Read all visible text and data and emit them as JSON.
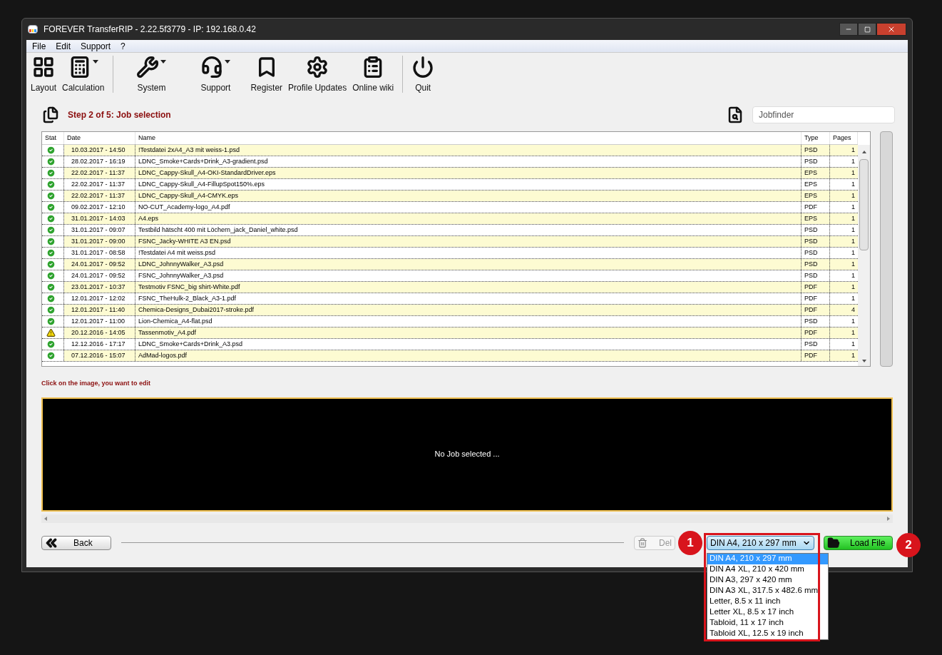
{
  "window": {
    "title": "FOREVER TransferRIP - 2.22.5f3779 - IP: 192.168.0.42"
  },
  "menu": [
    "File",
    "Edit",
    "Support",
    "?"
  ],
  "toolbar": [
    {
      "label": "Layout",
      "kind": "layout",
      "has_menu": false
    },
    {
      "label": "Calculation",
      "kind": "calculator",
      "has_menu": true
    },
    {
      "label": "System",
      "kind": "tools",
      "has_menu": true
    },
    {
      "label": "Support",
      "kind": "headset",
      "has_menu": true
    },
    {
      "label": "Register",
      "kind": "bookmark",
      "has_menu": false
    },
    {
      "label": "Profile Updates",
      "kind": "gears",
      "has_menu": false
    },
    {
      "label": "Online wiki",
      "kind": "clipboard",
      "has_menu": false
    },
    {
      "label": "Quit",
      "kind": "power",
      "has_menu": false
    }
  ],
  "step_title": "Step 2 of 5: Job selection",
  "jobfinder": {
    "placeholder": "Jobfinder"
  },
  "table": {
    "columns": [
      "Stat",
      "Date",
      "Name",
      "Type",
      "Pages"
    ],
    "rows": [
      {
        "kind": "ok",
        "date": "10.03.2017 - 14:50",
        "name": "!Testdatei 2xA4_A3 mit weiss-1.psd",
        "type": "PSD",
        "pages": "1"
      },
      {
        "kind": "ok",
        "date": "28.02.2017 - 16:19",
        "name": "LDNC_Smoke+Cards+Drink_A3-gradient.psd",
        "type": "PSD",
        "pages": "1"
      },
      {
        "kind": "ok",
        "date": "22.02.2017 - 11:37",
        "name": "LDNC_Cappy-Skull_A4-OKI-StandardDriver.eps",
        "type": "EPS",
        "pages": "1"
      },
      {
        "kind": "ok",
        "date": "22.02.2017 - 11:37",
        "name": "LDNC_Cappy-Skull_A4-FillupSpot150%.eps",
        "type": "EPS",
        "pages": "1"
      },
      {
        "kind": "ok",
        "date": "22.02.2017 - 11:37",
        "name": "LDNC_Cappy-Skull_A4-CMYK.eps",
        "type": "EPS",
        "pages": "1"
      },
      {
        "kind": "ok",
        "date": "09.02.2017 - 12:10",
        "name": "NO-CUT_Academy-logo_A4.pdf",
        "type": "PDF",
        "pages": "1"
      },
      {
        "kind": "ok",
        "date": "31.01.2017 - 14:03",
        "name": "A4.eps",
        "type": "EPS",
        "pages": "1"
      },
      {
        "kind": "ok",
        "date": "31.01.2017 - 09:07",
        "name": "Testbild hätscht 400 mit Löchern_jack_Daniel_white.psd",
        "type": "PSD",
        "pages": "1"
      },
      {
        "kind": "ok",
        "date": "31.01.2017 - 09:00",
        "name": "FSNC_Jacky-WHITE A3 EN.psd",
        "type": "PSD",
        "pages": "1"
      },
      {
        "kind": "ok",
        "date": "31.01.2017 - 08:58",
        "name": "!Testdatei A4 mit weiss.psd",
        "type": "PSD",
        "pages": "1"
      },
      {
        "kind": "ok",
        "date": "24.01.2017 - 09:52",
        "name": "LDNC_JohnnyWalker_A3.psd",
        "type": "PSD",
        "pages": "1"
      },
      {
        "kind": "ok",
        "date": "24.01.2017 - 09:52",
        "name": "FSNC_JohnnyWalker_A3.psd",
        "type": "PSD",
        "pages": "1"
      },
      {
        "kind": "ok",
        "date": "23.01.2017 - 10:37",
        "name": "Testmotiv FSNC_big shirt-White.pdf",
        "type": "PDF",
        "pages": "1"
      },
      {
        "kind": "ok",
        "date": "12.01.2017 - 12:02",
        "name": "FSNC_TheHulk-2_Black_A3-1.pdf",
        "type": "PDF",
        "pages": "1"
      },
      {
        "kind": "ok",
        "date": "12.01.2017 - 11:40",
        "name": "Chemica-Designs_Dubai2017-stroke.pdf",
        "type": "PDF",
        "pages": "4"
      },
      {
        "kind": "ok",
        "date": "12.01.2017 - 11:00",
        "name": "Lion-Chemica_A4-flat.psd",
        "type": "PSD",
        "pages": "1"
      },
      {
        "kind": "warning",
        "date": "20.12.2016 - 14:05",
        "name": "Tassenmotiv_A4.pdf",
        "type": "PDF",
        "pages": "1"
      },
      {
        "kind": "ok",
        "date": "12.12.2016 - 17:17",
        "name": "LDNC_Smoke+Cards+Drink_A3.psd",
        "type": "PSD",
        "pages": "1"
      },
      {
        "kind": "ok",
        "date": "07.12.2016 - 15:07",
        "name": "AdMad-logos.pdf",
        "type": "PDF",
        "pages": "1"
      }
    ]
  },
  "hint": "Click on the image, you want to edit",
  "preview": {
    "message": "No Job selected ..."
  },
  "buttons": {
    "back": "Back",
    "delete": "Del",
    "load": "Load File"
  },
  "format_select": {
    "value": "DIN A4, 210 x 297 mm",
    "expanded": true,
    "options": [
      {
        "label": "DIN A4, 210 x 297 mm",
        "selected": true
      },
      {
        "label": "DIN A4 XL, 210 x 420 mm",
        "selected": false
      },
      {
        "label": "DIN A3, 297 x 420 mm",
        "selected": false
      },
      {
        "label": "DIN A3 XL, 317.5 x 482.6 mm",
        "selected": false
      },
      {
        "label": "Letter, 8.5 x 11 inch",
        "selected": false
      },
      {
        "label": "Letter XL, 8.5 x 17 inch",
        "selected": false
      },
      {
        "label": "Tabloid, 11 x 17 inch",
        "selected": false
      },
      {
        "label": "Tabloid XL, 12.5 x 19 inch",
        "selected": false
      }
    ]
  },
  "callouts": [
    "1",
    "2"
  ]
}
